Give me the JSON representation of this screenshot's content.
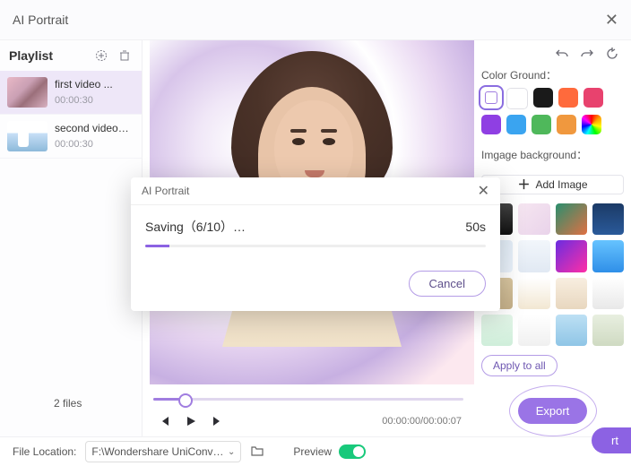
{
  "window": {
    "title": "AI Portrait"
  },
  "sidebar": {
    "header": "Playlist",
    "items": [
      {
        "name": "first video ...",
        "dur": "00:00:30",
        "selected": true
      },
      {
        "name": "second video…",
        "dur": "00:00:30",
        "selected": false
      }
    ],
    "files_count": "2 files"
  },
  "player": {
    "time": "00:00:00/00:00:07"
  },
  "right": {
    "color_ground_label": "Color Ground：",
    "colors": [
      {
        "hex": "#ffffff",
        "selected": true
      },
      {
        "hex": "#ffffff"
      },
      {
        "hex": "#1a1a1a"
      },
      {
        "hex": "#ff6a3c"
      },
      {
        "hex": "#e8426e"
      },
      {
        "hex": "#8f3fe3"
      },
      {
        "hex": "#3aa4f0"
      },
      {
        "hex": "#4fb85b"
      },
      {
        "hex": "#f0983e"
      },
      {
        "hex": "rainbow"
      }
    ],
    "image_bg_label": "Imgage background：",
    "add_image_label": "Add Image",
    "bg_tiles": [
      "linear-gradient(180deg,#444,#111)",
      "linear-gradient(135deg,#f6e6f1,#e9d3ea)",
      "linear-gradient(135deg,#2a8f6e,#e07043)",
      "linear-gradient(180deg,#1b3a66,#2a5a9a)",
      "linear-gradient(135deg,#dfeaf5,#eaf2fb)",
      "linear-gradient(180deg,#f2f6fb,#e1e9f3)",
      "linear-gradient(135deg,#6a2de0,#ff2ea6)",
      "linear-gradient(180deg,#66c3ff,#2f8fe8)",
      "linear-gradient(180deg,#d9c6a0,#c5b089)",
      "linear-gradient(180deg,#fff,#f2e7d2)",
      "linear-gradient(180deg,#f8eee0,#e8d7bf)",
      "linear-gradient(180deg,#fff,#e8e8e8)",
      "linear-gradient(180deg,#e4f6e9,#cfeeda)",
      "linear-gradient(180deg,#fff,#f0f0f0)",
      "linear-gradient(180deg,#bde0f4,#8fc5e6)",
      "linear-gradient(180deg,#e8efe0,#cfdac2)"
    ],
    "apply_all_label": "Apply to all",
    "export_label": "Export",
    "floating_rt_label": "rt"
  },
  "footer": {
    "file_location_label": "File Location:",
    "path_display": "F:\\Wondershare UniConverte…",
    "preview_label": "Preview"
  },
  "dialog": {
    "title": "AI Portrait",
    "status": "Saving（6/10）…",
    "eta": "50s",
    "cancel_label": "Cancel"
  }
}
